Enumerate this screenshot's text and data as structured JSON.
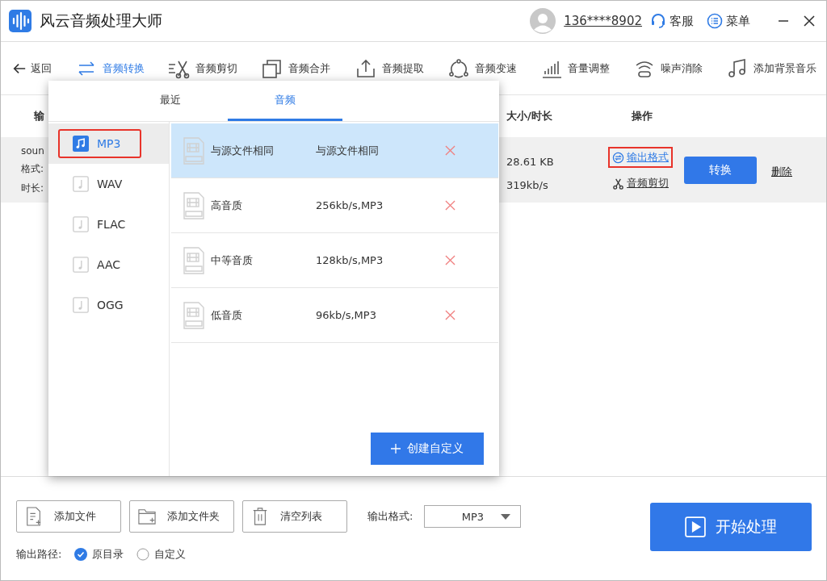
{
  "title_bar": {
    "app_title": "风云音频处理大师",
    "phone": "136****8902",
    "service": "客服",
    "menu": "菜单"
  },
  "toolbar": {
    "back": "返回",
    "items": [
      {
        "label": "音频转换",
        "kind": "convert",
        "selected": true
      },
      {
        "label": "音频剪切",
        "kind": "cut",
        "selected": false
      },
      {
        "label": "音频合并",
        "kind": "merge",
        "selected": false
      },
      {
        "label": "音频提取",
        "kind": "extract",
        "selected": false
      },
      {
        "label": "音频变速",
        "kind": "speed",
        "selected": false
      },
      {
        "label": "音量调整",
        "kind": "volume",
        "selected": false
      },
      {
        "label": "噪声消除",
        "kind": "noise",
        "selected": false
      },
      {
        "label": "添加背景音乐",
        "kind": "music",
        "selected": false
      }
    ]
  },
  "table": {
    "columns": [
      "输",
      "大小/时长",
      "操作"
    ],
    "rows": [
      {
        "name": "soun",
        "format_label": "格式:",
        "duration_label": "时长:",
        "size": "28.61 KB",
        "bitrate": "319kb/s",
        "output_format_link": "输出格式",
        "output_format_highlighted": true,
        "cut_link": "音频剪切",
        "convert_button": "转换",
        "delete_link": "删除"
      }
    ]
  },
  "format_popup": {
    "tabs": [
      {
        "label": "最近",
        "selected": false
      },
      {
        "label": "音频",
        "selected": true
      }
    ],
    "formats": [
      {
        "label": "MP3",
        "selected": true,
        "highlighted": true
      },
      {
        "label": "WAV",
        "selected": false,
        "highlighted": false
      },
      {
        "label": "FLAC",
        "selected": false,
        "highlighted": false
      },
      {
        "label": "AAC",
        "selected": false,
        "highlighted": false
      },
      {
        "label": "OGG",
        "selected": false,
        "highlighted": false
      }
    ],
    "presets": [
      {
        "name": "与源文件相同",
        "detail": "与源文件相同",
        "selected": true
      },
      {
        "name": "高音质",
        "detail": "256kb/s,MP3",
        "selected": false
      },
      {
        "name": "中等音质",
        "detail": "128kb/s,MP3",
        "selected": false
      },
      {
        "name": "低音质",
        "detail": "96kb/s,MP3",
        "selected": false
      }
    ],
    "create_button": "创建自定义"
  },
  "bottom": {
    "buttons": [
      {
        "label": "添加文件",
        "kind": "file"
      },
      {
        "label": "添加文件夹",
        "kind": "folder"
      },
      {
        "label": "清空列表",
        "kind": "trash"
      }
    ],
    "output_format_label": "输出格式:",
    "output_format_value": "MP3",
    "start_button": "开始处理",
    "output_path_label": "输出路径:",
    "path_options": [
      {
        "label": "原目录",
        "selected": true
      },
      {
        "label": "自定义",
        "selected": false
      }
    ]
  }
}
